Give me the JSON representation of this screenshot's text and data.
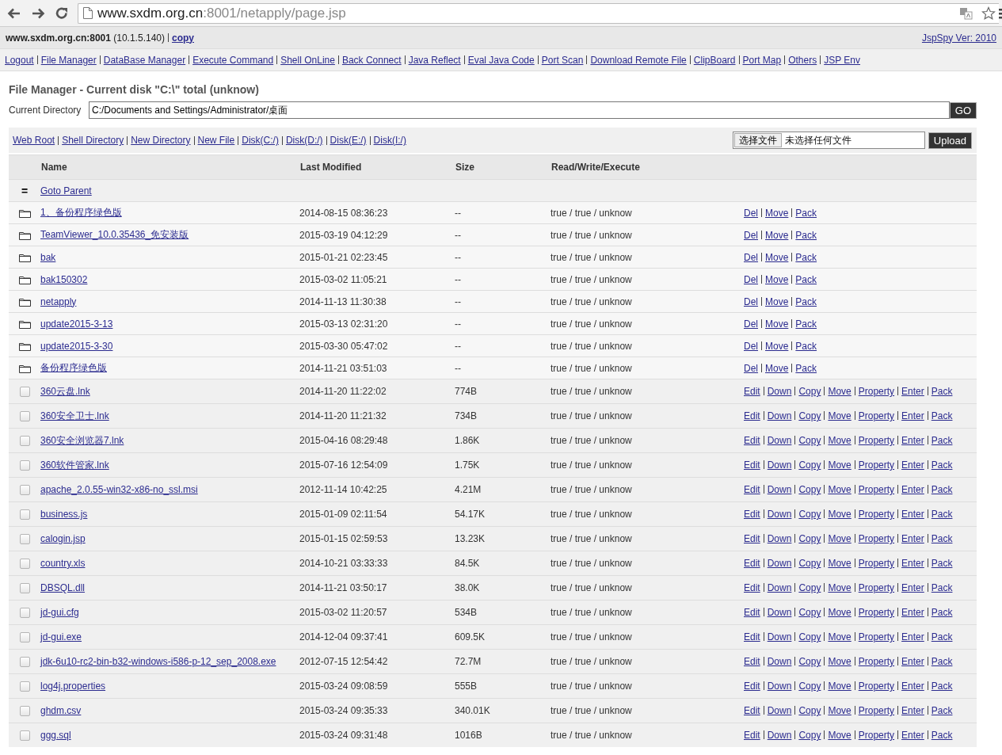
{
  "browser": {
    "url_host": "www.sxdm.org.cn",
    "url_rest": ":8001/netapply/page.jsp"
  },
  "info_bar": {
    "server": "**www.sxdm.org.cn:8001** (10.1.5.140)",
    "copy_link": "copy",
    "version_link": "JspSpy Ver: 2010"
  },
  "nav_links": [
    "Logout",
    "File Manager",
    "DataBase Manager",
    "Execute Command",
    "Shell OnLine",
    "Back Connect",
    "Java Reflect",
    "Eval Java Code",
    "Port Scan",
    "Download Remote File",
    "ClipBoard",
    "Port Map",
    "Others",
    "JSP Env"
  ],
  "title": "File Manager - Current disk \"C:\\\" total (unknow)",
  "current_directory": {
    "label": "Current Directory",
    "value": "C:/Documents and Settings/Administrator/桌面",
    "button": "GO"
  },
  "toolbar_links": [
    "Web Root",
    "Shell Directory",
    "New Directory",
    "New File",
    "Disk(C:/)",
    "Disk(D:/)",
    "Disk(E:/)",
    "Disk(I:/)"
  ],
  "upload": {
    "choose_button": "选择文件",
    "file_status": "未选择任何文件",
    "button": "Upload"
  },
  "table": {
    "columns": [
      "Name",
      "Last Modified",
      "Size",
      "Read/Write/Execute"
    ],
    "parent_row": {
      "symbol": "=",
      "link": "Goto Parent"
    },
    "rows": [
      {
        "kind": "dir",
        "name": "1、备份程序绿色版",
        "modified": "2014-08-15 08:36:23",
        "size": "--",
        "permissions": "true / true / unknow",
        "actions": [
          "Del",
          "Move",
          "Pack"
        ]
      },
      {
        "kind": "dir",
        "name": "TeamViewer_10.0.35436_免安装版",
        "modified": "2015-03-19 04:12:29",
        "size": "--",
        "permissions": "true / true / unknow",
        "actions": [
          "Del",
          "Move",
          "Pack"
        ]
      },
      {
        "kind": "dir",
        "name": "bak",
        "modified": "2015-01-21 02:23:45",
        "size": "--",
        "permissions": "true / true / unknow",
        "actions": [
          "Del",
          "Move",
          "Pack"
        ]
      },
      {
        "kind": "dir",
        "name": "bak150302",
        "modified": "2015-03-02 11:05:21",
        "size": "--",
        "permissions": "true / true / unknow",
        "actions": [
          "Del",
          "Move",
          "Pack"
        ]
      },
      {
        "kind": "dir",
        "name": "netapply",
        "modified": "2014-11-13 11:30:38",
        "size": "--",
        "permissions": "true / true / unknow",
        "actions": [
          "Del",
          "Move",
          "Pack"
        ]
      },
      {
        "kind": "dir",
        "name": "update2015-3-13",
        "modified": "2015-03-13 02:31:20",
        "size": "--",
        "permissions": "true / true / unknow",
        "actions": [
          "Del",
          "Move",
          "Pack"
        ]
      },
      {
        "kind": "dir",
        "name": "update2015-3-30",
        "modified": "2015-03-30 05:47:02",
        "size": "--",
        "permissions": "true / true / unknow",
        "actions": [
          "Del",
          "Move",
          "Pack"
        ]
      },
      {
        "kind": "dir",
        "name": "备份程序绿色版",
        "modified": "2014-11-21 03:51:03",
        "size": "--",
        "permissions": "true / true / unknow",
        "actions": [
          "Del",
          "Move",
          "Pack"
        ]
      },
      {
        "kind": "file",
        "checked": false,
        "name": "360云盘.lnk",
        "modified": "2014-11-20 11:22:02",
        "size": "774B",
        "permissions": "true / true / unknow",
        "actions": [
          "Edit",
          "Down",
          "Copy",
          "Move",
          "Property",
          "Enter",
          "Pack"
        ]
      },
      {
        "kind": "file",
        "checked": false,
        "name": "360安全卫士.lnk",
        "modified": "2014-11-20 11:21:32",
        "size": "734B",
        "permissions": "true / true / unknow",
        "actions": [
          "Edit",
          "Down",
          "Copy",
          "Move",
          "Property",
          "Enter",
          "Pack"
        ]
      },
      {
        "kind": "file",
        "checked": false,
        "name": "360安全浏览器7.lnk",
        "modified": "2015-04-16 08:29:48",
        "size": "1.86K",
        "permissions": "true / true / unknow",
        "actions": [
          "Edit",
          "Down",
          "Copy",
          "Move",
          "Property",
          "Enter",
          "Pack"
        ]
      },
      {
        "kind": "file",
        "checked": false,
        "name": "360软件管家.lnk",
        "modified": "2015-07-16 12:54:09",
        "size": "1.75K",
        "permissions": "true / true / unknow",
        "actions": [
          "Edit",
          "Down",
          "Copy",
          "Move",
          "Property",
          "Enter",
          "Pack"
        ]
      },
      {
        "kind": "file",
        "checked": false,
        "name": "apache_2.0.55-win32-x86-no_ssl.msi",
        "modified": "2012-11-14 10:42:25",
        "size": "4.21M",
        "permissions": "true / true / unknow",
        "actions": [
          "Edit",
          "Down",
          "Copy",
          "Move",
          "Property",
          "Enter",
          "Pack"
        ]
      },
      {
        "kind": "file",
        "checked": false,
        "name": "business.js",
        "modified": "2015-01-09 02:11:54",
        "size": "54.17K",
        "permissions": "true / true / unknow",
        "actions": [
          "Edit",
          "Down",
          "Copy",
          "Move",
          "Property",
          "Enter",
          "Pack"
        ]
      },
      {
        "kind": "file",
        "checked": false,
        "name": "calogin.jsp",
        "modified": "2015-01-15 02:59:53",
        "size": "13.23K",
        "permissions": "true / true / unknow",
        "actions": [
          "Edit",
          "Down",
          "Copy",
          "Move",
          "Property",
          "Enter",
          "Pack"
        ]
      },
      {
        "kind": "file",
        "checked": false,
        "name": "country.xls",
        "modified": "2014-10-21 03:33:33",
        "size": "84.5K",
        "permissions": "true / true / unknow",
        "actions": [
          "Edit",
          "Down",
          "Copy",
          "Move",
          "Property",
          "Enter",
          "Pack"
        ]
      },
      {
        "kind": "file",
        "checked": false,
        "name": "DBSQL.dll",
        "modified": "2014-11-21 03:50:17",
        "size": "38.0K",
        "permissions": "true / true / unknow",
        "actions": [
          "Edit",
          "Down",
          "Copy",
          "Move",
          "Property",
          "Enter",
          "Pack"
        ]
      },
      {
        "kind": "file",
        "checked": false,
        "name": "jd-gui.cfg",
        "modified": "2015-03-02 11:20:57",
        "size": "534B",
        "permissions": "true / true / unknow",
        "actions": [
          "Edit",
          "Down",
          "Copy",
          "Move",
          "Property",
          "Enter",
          "Pack"
        ]
      },
      {
        "kind": "file",
        "checked": false,
        "name": "jd-gui.exe",
        "modified": "2014-12-04 09:37:41",
        "size": "609.5K",
        "permissions": "true / true / unknow",
        "actions": [
          "Edit",
          "Down",
          "Copy",
          "Move",
          "Property",
          "Enter",
          "Pack"
        ]
      },
      {
        "kind": "file",
        "checked": false,
        "name": "jdk-6u10-rc2-bin-b32-windows-i586-p-12_sep_2008.exe",
        "modified": "2012-07-15 12:54:42",
        "size": "72.7M",
        "permissions": "true / true / unknow",
        "actions": [
          "Edit",
          "Down",
          "Copy",
          "Move",
          "Property",
          "Enter",
          "Pack"
        ]
      },
      {
        "kind": "file",
        "checked": false,
        "name": "log4j.properties",
        "modified": "2015-03-24 09:08:59",
        "size": "555B",
        "permissions": "true / true / unknow",
        "actions": [
          "Edit",
          "Down",
          "Copy",
          "Move",
          "Property",
          "Enter",
          "Pack"
        ]
      },
      {
        "kind": "file",
        "checked": false,
        "name": "ghdm.csv",
        "modified": "2015-03-24 09:35:33",
        "size": "340.01K",
        "permissions": "true / true / unknow",
        "actions": [
          "Edit",
          "Down",
          "Copy",
          "Move",
          "Property",
          "Enter",
          "Pack"
        ]
      },
      {
        "kind": "file",
        "checked": false,
        "name": "ggg.sql",
        "modified": "2015-03-24 09:31:48",
        "size": "1016B",
        "permissions": "true / true / unknow",
        "actions": [
          "Edit",
          "Down",
          "Copy",
          "Move",
          "Property",
          "Enter",
          "Pack"
        ]
      }
    ]
  }
}
